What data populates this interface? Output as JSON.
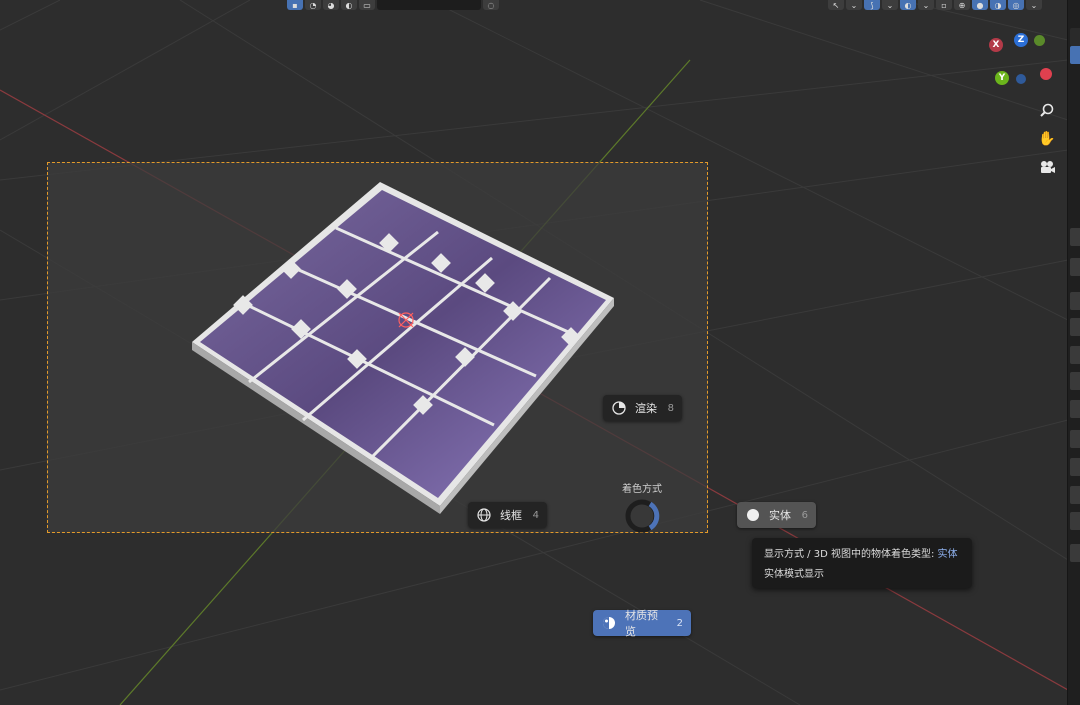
{
  "pie_menu": {
    "title": "着色方式",
    "items": {
      "rendered": {
        "label": "渲染",
        "key": "8"
      },
      "wireframe": {
        "label": "线框",
        "key": "4"
      },
      "solid": {
        "label": "实体",
        "key": "6"
      },
      "material": {
        "label": "材质预览",
        "key": "2"
      }
    }
  },
  "tooltip": {
    "line1_prefix": "显示方式 / 3D 视图中的物体着色类型:",
    "line1_value": "实体",
    "line2": "实体模式显示"
  },
  "gizmo": {
    "x": "X",
    "y": "Y",
    "z": "Z"
  },
  "colors": {
    "accent": "#4772b3",
    "selected_item": "#4d73b8",
    "camera_frame": "#e39a2a",
    "axis_x": "#d5404f",
    "axis_y": "#7ac41c",
    "axis_z": "#2c8fff",
    "panel": "#8a6fb5"
  },
  "icons": [
    "zoom-icon",
    "hand-pan-icon",
    "camera-icon",
    "globe-wireframe-icon",
    "sphere-solid-icon",
    "sphere-material-icon",
    "sphere-rendered-icon"
  ]
}
